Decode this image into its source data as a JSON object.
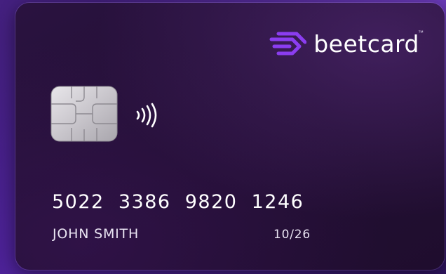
{
  "card": {
    "brand": {
      "name": "beetcard",
      "trademark": "™",
      "logo_icon": "beetcard-logo-icon",
      "logo_color": "#8b3df0"
    },
    "chip_icon": "emv-chip-icon",
    "contactless_icon": "contactless-icon",
    "number": "5022  3386  9820  1246",
    "holder": "JOHN SMITH",
    "expiry": "10/26"
  }
}
